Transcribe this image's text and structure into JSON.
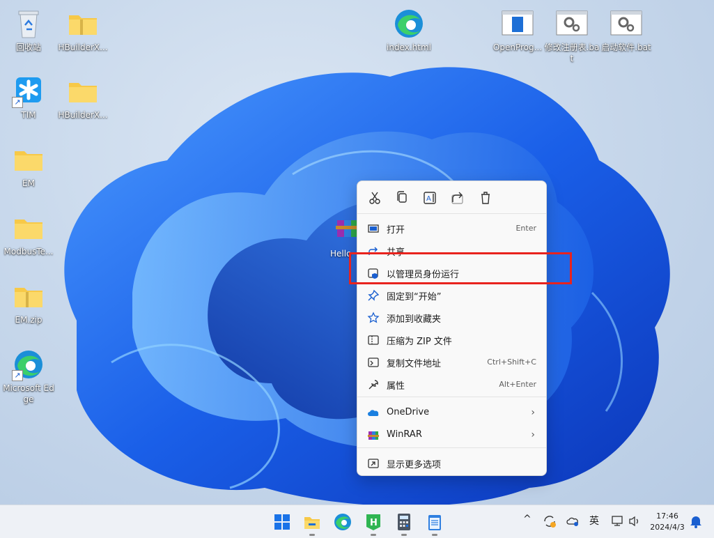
{
  "desktop": {
    "icons": [
      {
        "label": "回收站"
      },
      {
        "label": "HBuilderX..."
      },
      {
        "label": "TIM"
      },
      {
        "label": "HBuilderX..."
      },
      {
        "label": "EM"
      },
      {
        "label": "ModbusTe..."
      },
      {
        "label": "EM.zip"
      },
      {
        "label": "Microsoft Edge"
      },
      {
        "label": "index.html"
      },
      {
        "label": "OpenProg..."
      },
      {
        "label": "修改注册表.bat"
      },
      {
        "label": "启动软件.bat"
      }
    ],
    "selected_file_label": "Hello"
  },
  "context_menu": {
    "toolbar": [
      "cut-icon",
      "copy-icon",
      "rename-icon",
      "share-icon",
      "delete-icon"
    ],
    "items": [
      {
        "label": "打开",
        "shortcut": "Enter",
        "icon": "open-icon"
      },
      {
        "label": "共享",
        "shortcut": "",
        "icon": "share-icon"
      },
      {
        "label": "以管理员身份运行",
        "shortcut": "",
        "icon": "shield-icon"
      },
      {
        "label": "固定到“开始”",
        "shortcut": "",
        "icon": "pin-icon"
      },
      {
        "label": "添加到收藏夹",
        "shortcut": "",
        "icon": "star-icon"
      },
      {
        "label": "压缩为 ZIP 文件",
        "shortcut": "",
        "icon": "zip-icon"
      },
      {
        "label": "复制文件地址",
        "shortcut": "Ctrl+Shift+C",
        "icon": "copy-path-icon"
      },
      {
        "label": "属性",
        "shortcut": "Alt+Enter",
        "icon": "wrench-icon"
      },
      {
        "label": "OneDrive",
        "shortcut": "",
        "icon": "onedrive-icon"
      },
      {
        "label": "WinRAR",
        "shortcut": "",
        "icon": "winrar-icon"
      },
      {
        "label": "显示更多选项",
        "shortcut": "",
        "icon": "more-options-icon"
      }
    ],
    "submenu_chevron": "›"
  },
  "taskbar": {
    "apps": [
      "start-icon",
      "file-explorer-icon",
      "edge-icon",
      "hbuilderx-icon",
      "calculator-icon",
      "notepad-icon"
    ],
    "tray": {
      "chevron": "^",
      "ime": "英",
      "time": "17:46",
      "date": "2024/4/3"
    }
  },
  "colors": {
    "accent": "#0067c0",
    "highlight_box": "#e8231e",
    "menu_bg": "#f9f9f9",
    "taskbar_bg": "#eef1f6"
  }
}
